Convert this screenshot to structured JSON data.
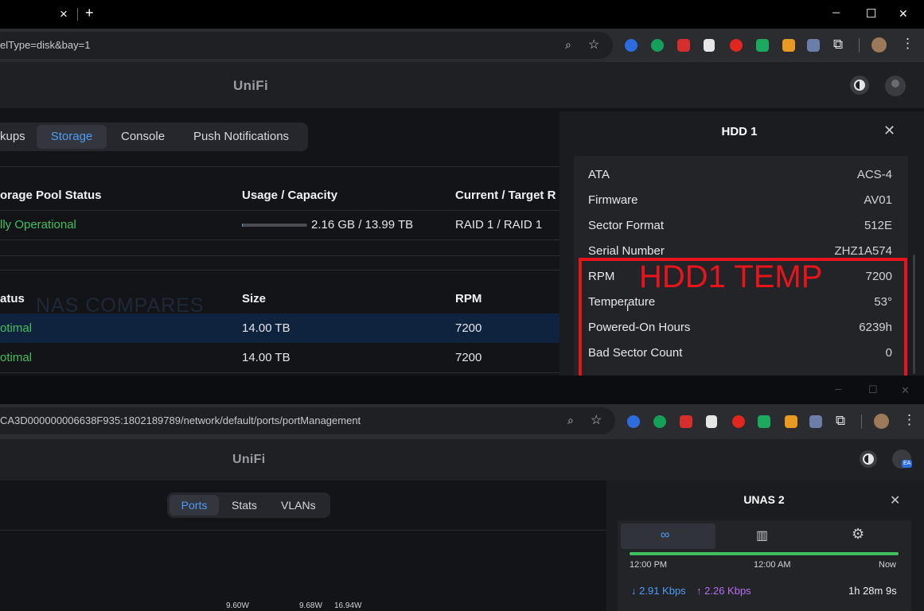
{
  "window1": {
    "tab_close": "×",
    "tab_new": "+",
    "win_controls": {
      "min": "─",
      "max": "☐",
      "close": "✕"
    },
    "url": "elType=disk&bay=1",
    "logo": "UniFi",
    "tabs": [
      {
        "label": "kups"
      },
      {
        "label": "Storage",
        "active": true
      },
      {
        "label": "Console"
      },
      {
        "label": "Push Notifications"
      }
    ],
    "pool_table": {
      "headers": [
        "orage Pool Status",
        "Usage / Capacity",
        "Current / Target R"
      ],
      "row": {
        "status": "lly Operational",
        "usage": "2.16 GB / 13.99 TB",
        "raid": "RAID 1 / RAID 1",
        "usage_fill": 0.0002
      }
    },
    "disk_table": {
      "headers": [
        "atus",
        "Size",
        "RPM"
      ],
      "rows": [
        {
          "status": "otimal",
          "size": "14.00 TB",
          "rpm": "7200",
          "selected": true
        },
        {
          "status": "otimal",
          "size": "14.00 TB",
          "rpm": "7200",
          "selected": false
        }
      ]
    },
    "watermark": "NAS COMPARES",
    "panel": {
      "title": "HDD 1",
      "rows": [
        {
          "key": "ATA",
          "value": "ACS-4"
        },
        {
          "key": "Firmware",
          "value": "AV01"
        },
        {
          "key": "Sector Format",
          "value": "512E"
        },
        {
          "key": "Serial Number",
          "value": "ZHZ1A574"
        },
        {
          "key": "RPM",
          "value": "7200"
        },
        {
          "key": "Temperature",
          "value": "53°"
        },
        {
          "key": "Powered-On Hours",
          "value": "6239h"
        },
        {
          "key": "Bad Sector Count",
          "value": "0"
        }
      ],
      "annotation": "HDD1 TEMP",
      "annotation_color": "#e8141b"
    }
  },
  "window2": {
    "win_controls": {
      "min": "─",
      "max": "☐",
      "close": "✕"
    },
    "url": "CA3D000000006638F935:1802189789/network/default/ports/portManagement",
    "logo": "UniFi",
    "avatar_badge": "EA",
    "tabs": [
      {
        "label": "Ports",
        "active": true
      },
      {
        "label": "Stats"
      },
      {
        "label": "VLANs"
      }
    ],
    "power_labels": [
      "9.60W",
      "9.68W",
      "16.94W"
    ],
    "panel": {
      "title": "UNAS 2",
      "timeline": [
        "12:00 PM",
        "12:00 AM",
        "Now"
      ],
      "down": "2.91 Kbps",
      "up": "2.26 Kbps",
      "uptime": "1h 28m 9s",
      "status_color": "#3fbf5f"
    }
  }
}
